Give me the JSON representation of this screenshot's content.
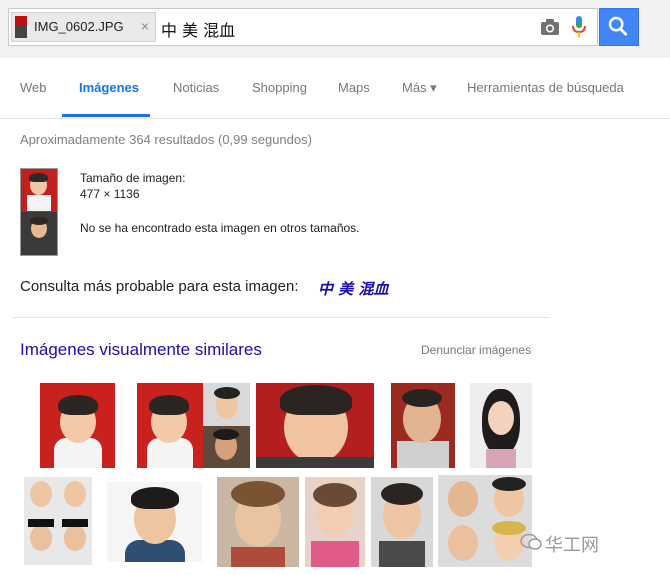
{
  "search": {
    "image_chip_label": "IMG_0602.JPG",
    "chip_close": "×",
    "query": "中 美 混血"
  },
  "tabs": [
    {
      "label": "Web"
    },
    {
      "label": "Imágenes"
    },
    {
      "label": "Noticias"
    },
    {
      "label": "Shopping"
    },
    {
      "label": "Maps"
    },
    {
      "label": "Más ▾"
    },
    {
      "label": "Herramientas de búsqueda"
    }
  ],
  "results": {
    "stats": "Aproximadamente 364 resultados (0,99 segundos)",
    "size_label": "Tamaño de imagen:",
    "size_value": "477 × 1136",
    "no_other_sizes": "No se ha encontrado esta imagen en otros tamaños.",
    "best_guess_label": "Consulta más probable para esta imagen:",
    "best_guess_link": "中 美 混血"
  },
  "similar": {
    "title": "Imágenes visualmente similares",
    "report": "Denunciar imágenes"
  },
  "watermark": "华工网",
  "colors": {
    "accent": "#1a73e8",
    "link": "#1a0dab",
    "search_button": "#4285f4"
  }
}
